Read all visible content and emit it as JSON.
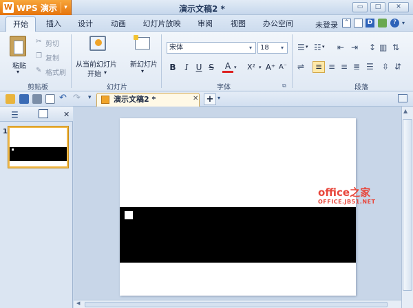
{
  "app": {
    "logo": "W",
    "name": "WPS 演示",
    "menu_arrow": "▾"
  },
  "title": "演示文稿2 *",
  "window": {
    "minimize": "▭",
    "restore": "□",
    "close": "✕"
  },
  "menu_tabs": [
    "开始",
    "插入",
    "设计",
    "动画",
    "幻灯片放映",
    "审阅",
    "视图",
    "办公空间"
  ],
  "account": {
    "login": "未登录"
  },
  "ribbon": {
    "clipboard": {
      "paste": "粘贴",
      "cut": "剪切",
      "copy": "复制",
      "format_painter": "格式刷",
      "group": "剪贴板"
    },
    "slides": {
      "from_current": "从当前幻灯片",
      "from_current_2": "开始",
      "new_slide": "新幻灯片",
      "group": "幻灯片"
    },
    "font": {
      "name": "宋体",
      "size": "18",
      "bold": "B",
      "italic": "I",
      "underline": "U",
      "strike": "S",
      "color": "A",
      "superscript": "X²",
      "grow": "A⁺",
      "shrink": "A⁻",
      "group": "字体"
    },
    "paragraph": {
      "group": "段落"
    }
  },
  "doc_tab": {
    "name": "演示文稿2 *",
    "close": "✕",
    "new": "+",
    "more": "▾"
  },
  "left_pane": {
    "close": "✕",
    "slide_number": "1"
  },
  "watermark": {
    "brand": "office之家",
    "url": "OFFICE.JB51.NET"
  },
  "colors": {
    "accent": "#e5730c",
    "ribbon": "#e8eff8",
    "watermark": "#e8463b"
  }
}
